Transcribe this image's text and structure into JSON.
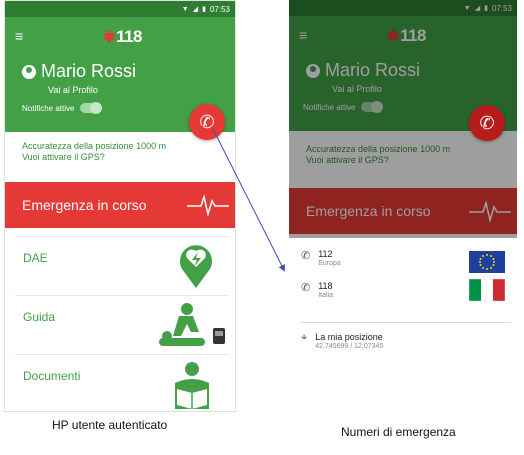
{
  "status": {
    "time": "07:53"
  },
  "app": {
    "logo": "118",
    "user_name": "Mario Rossi",
    "profile_link": "Vai al Profilo",
    "notifications_label": "Notifiche attive",
    "gps_line1": "Accuratezza della posizione 1000 m",
    "gps_line2": "Vuoi attivare il GPS?",
    "emergency_label": "Emergenza in corso",
    "menu": [
      {
        "label": "DAE",
        "icon": "aed-icon"
      },
      {
        "label": "Guida",
        "icon": "cpr-guide-icon"
      },
      {
        "label": "Documenti",
        "icon": "reading-person-icon"
      }
    ]
  },
  "emergency_numbers": {
    "items": [
      {
        "number": "112",
        "country": "Europa",
        "flag": "eu-flag-icon"
      },
      {
        "number": "118",
        "country": "Italia",
        "flag": "italy-flag-icon"
      }
    ],
    "position_label": "La mia posizione",
    "position_coords": "42,745699 / 12,07345"
  },
  "captions": {
    "left": "HP utente autenticato",
    "right": "Numeri di emergenza"
  },
  "colors": {
    "green": "#43a047",
    "dark_green": "#2e7d32",
    "red": "#e53935"
  }
}
